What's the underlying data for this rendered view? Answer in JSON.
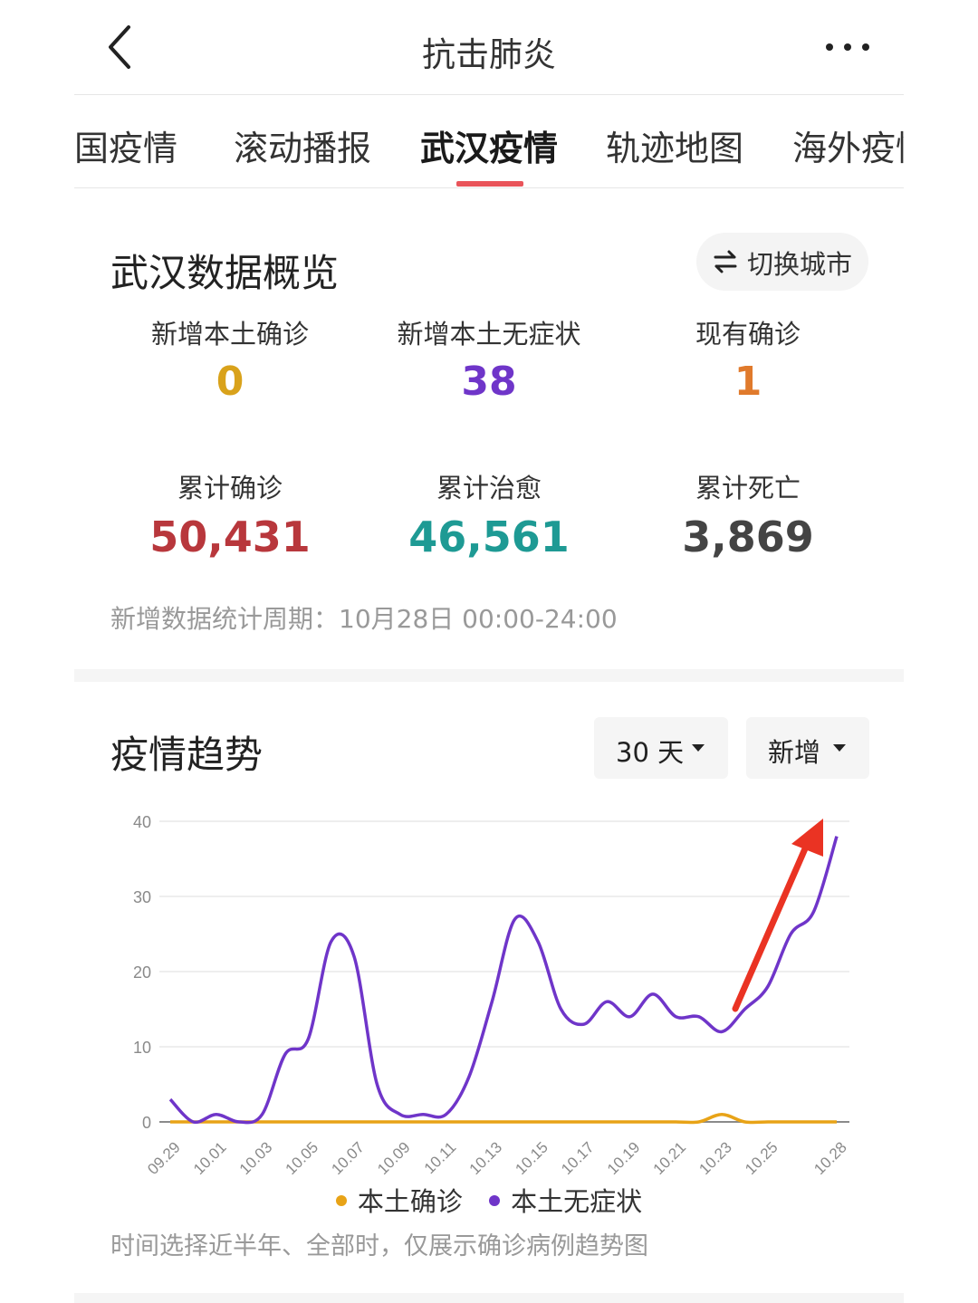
{
  "header": {
    "title": "抗击肺炎",
    "back_icon": "chevron-left-icon",
    "more_icon": "more-dots-icon"
  },
  "tabs": [
    {
      "label": "全国疫情",
      "active": false
    },
    {
      "label": "滚动播报",
      "active": false
    },
    {
      "label": "武汉疫情",
      "active": true
    },
    {
      "label": "轨迹地图",
      "active": false
    },
    {
      "label": "海外疫情",
      "active": false
    }
  ],
  "overview": {
    "title": "武汉数据概览",
    "switch_label": "切换城市",
    "stats": [
      {
        "label": "新增本土确诊",
        "value": "0",
        "color": "#d9a21b"
      },
      {
        "label": "新增本土无症状",
        "value": "38",
        "color": "#6f35c9"
      },
      {
        "label": "现有确诊",
        "value": "1",
        "color": "#e07a2c"
      },
      {
        "label": "累计确诊",
        "value": "50,431",
        "color": "#b8373c"
      },
      {
        "label": "累计治愈",
        "value": "46,561",
        "color": "#1e9a94"
      },
      {
        "label": "累计死亡",
        "value": "3,869",
        "color": "#444444"
      }
    ],
    "period": "新增数据统计周期：10月28日 00:00-24:00"
  },
  "trend": {
    "title": "疫情趋势",
    "range_label": "30 天",
    "type_label": "新增",
    "note": "时间选择近半年、全部时，仅展示确诊病例趋势图"
  },
  "chart_data": {
    "type": "line",
    "ylim": [
      0,
      40
    ],
    "yticks": [
      "0",
      "10",
      "20",
      "30",
      "40"
    ],
    "x": [
      "09.29",
      "09.30",
      "10.01",
      "10.02",
      "10.03",
      "10.04",
      "10.05",
      "10.06",
      "10.07",
      "10.08",
      "10.09",
      "10.10",
      "10.11",
      "10.12",
      "10.13",
      "10.14",
      "10.15",
      "10.16",
      "10.17",
      "10.18",
      "10.19",
      "10.20",
      "10.21",
      "10.22",
      "10.23",
      "10.24",
      "10.25",
      "10.26",
      "10.27",
      "10.28"
    ],
    "xticks": [
      "09.29",
      "10.01",
      "10.03",
      "10.05",
      "10.07",
      "10.09",
      "10.11",
      "10.13",
      "10.15",
      "10.17",
      "10.19",
      "10.21",
      "10.23",
      "10.25",
      "10.28"
    ],
    "grid": true,
    "legend_position": "bottom",
    "series": [
      {
        "name": "本土确诊",
        "color": "#e8a317",
        "values": [
          0,
          0,
          0,
          0,
          0,
          0,
          0,
          0,
          0,
          0,
          0,
          0,
          0,
          0,
          0,
          0,
          0,
          0,
          0,
          0,
          0,
          0,
          0,
          0,
          1,
          0,
          0,
          0,
          0,
          0
        ]
      },
      {
        "name": "本土无症状",
        "color": "#6f35c9",
        "values": [
          3,
          0,
          1,
          0,
          1,
          9,
          11,
          24,
          22,
          5,
          1,
          1,
          1,
          6,
          16,
          27,
          24,
          15,
          13,
          16,
          14,
          17,
          14,
          14,
          12,
          15,
          18,
          25,
          28,
          38
        ]
      }
    ],
    "annotations": [
      {
        "type": "arrow",
        "color": "#ea3323"
      }
    ]
  }
}
